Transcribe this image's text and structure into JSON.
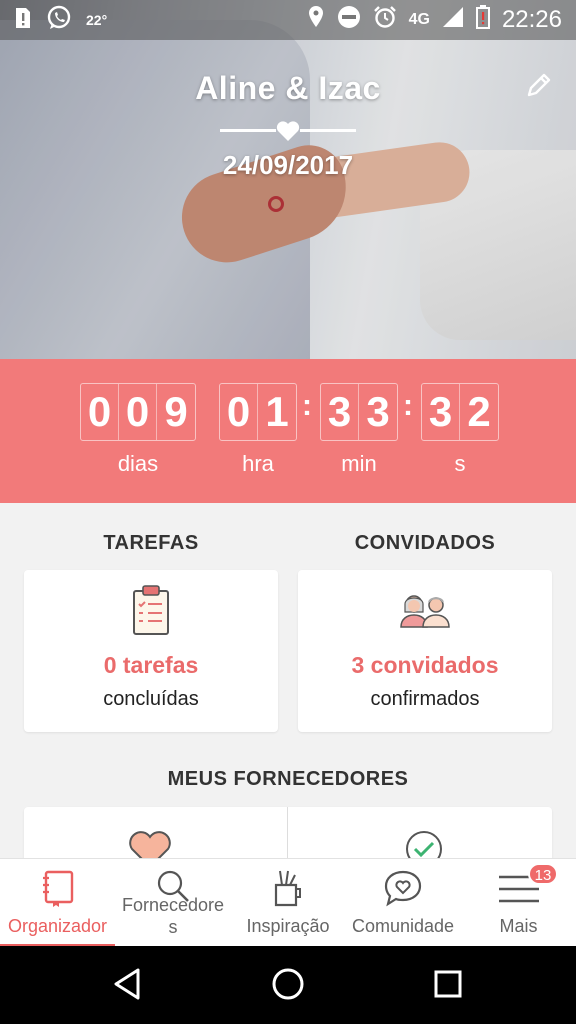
{
  "status_bar": {
    "temperature": "22°",
    "network": "4G",
    "time": "22:26",
    "icons": [
      "sim-alert-icon",
      "whatsapp-icon",
      "location-icon",
      "do-not-disturb-icon",
      "alarm-icon",
      "signal-icon",
      "battery-low-icon"
    ]
  },
  "hero": {
    "couple_names": "Aline & Izac",
    "wedding_date": "24/09/2017",
    "edit_icon": "pencil-icon",
    "divider_icon": "heart-icon"
  },
  "countdown": {
    "days": [
      "0",
      "0",
      "9"
    ],
    "hours": [
      "0",
      "1"
    ],
    "minutes": [
      "3",
      "3"
    ],
    "seconds": [
      "3",
      "2"
    ],
    "days_label": "dias",
    "hours_label": "hra",
    "minutes_label": "min",
    "seconds_label": "s",
    "separator": ":"
  },
  "tasks": {
    "title": "TAREFAS",
    "count_text": "0 tarefas",
    "sub_text": "concluídas",
    "icon": "clipboard-icon"
  },
  "guests": {
    "title": "CONVIDADOS",
    "count_text": "3 convidados",
    "sub_text": "confirmados",
    "icon": "couple-icon"
  },
  "vendors": {
    "title": "MEUS FORNECEDORES",
    "icons": [
      "heart-icon",
      "check-circle-icon"
    ]
  },
  "bottom_nav": {
    "items": [
      {
        "label": "Organizador",
        "icon": "notebook-icon",
        "active": true
      },
      {
        "label_line1": "Fornecedore",
        "label_line2": "s",
        "icon": "search-icon"
      },
      {
        "label": "Inspiração",
        "icon": "brush-cup-icon"
      },
      {
        "label": "Comunidade",
        "icon": "chat-heart-icon"
      },
      {
        "label": "Mais",
        "icon": "menu-icon",
        "badge": "13"
      }
    ]
  },
  "colors": {
    "accent": "#f27a7a",
    "accent_text": "#ea6b6b",
    "background": "#f2f2f2"
  }
}
